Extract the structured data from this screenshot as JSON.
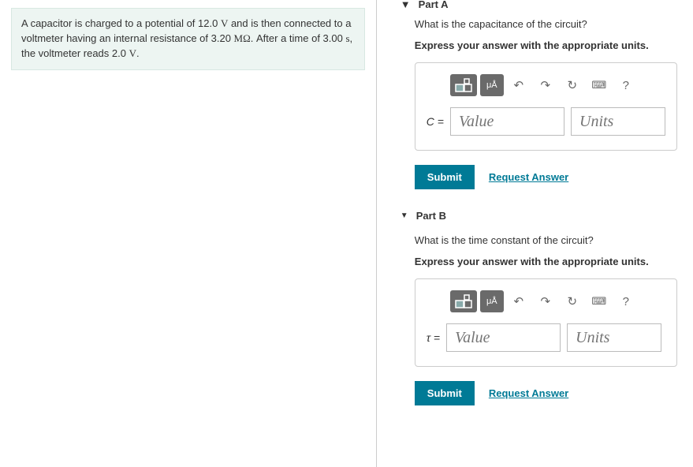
{
  "problem": {
    "text_before_v1": "A capacitor is charged to a potential of 12.0 ",
    "v1_unit": "V",
    "text_mid1": " and is then connected to a voltmeter having an internal resistance of 3.20 ",
    "mohm": "MΩ",
    "text_mid2": ". After a time of 3.00 ",
    "s_unit": "s",
    "text_mid3": ", the voltmeter reads 2.0 ",
    "v2_unit": "V",
    "text_end": "."
  },
  "partA": {
    "label": "Part A",
    "question": "What is the capacitance of the circuit?",
    "instruction": "Express your answer with the appropriate units.",
    "var": "C",
    "equals": " = ",
    "value_placeholder": "Value",
    "units_placeholder": "Units",
    "submit": "Submit",
    "request": "Request Answer"
  },
  "partB": {
    "label": "Part B",
    "question": "What is the time constant of the circuit?",
    "instruction": "Express your answer with the appropriate units.",
    "var": "τ",
    "equals": " = ",
    "value_placeholder": "Value",
    "units_placeholder": "Units",
    "submit": "Submit",
    "request": "Request Answer"
  },
  "toolbar": {
    "mu_a": "μÅ",
    "undo": "↶",
    "redo": "↷",
    "reset": "↻",
    "keyboard": "⌨",
    "help": "?"
  }
}
